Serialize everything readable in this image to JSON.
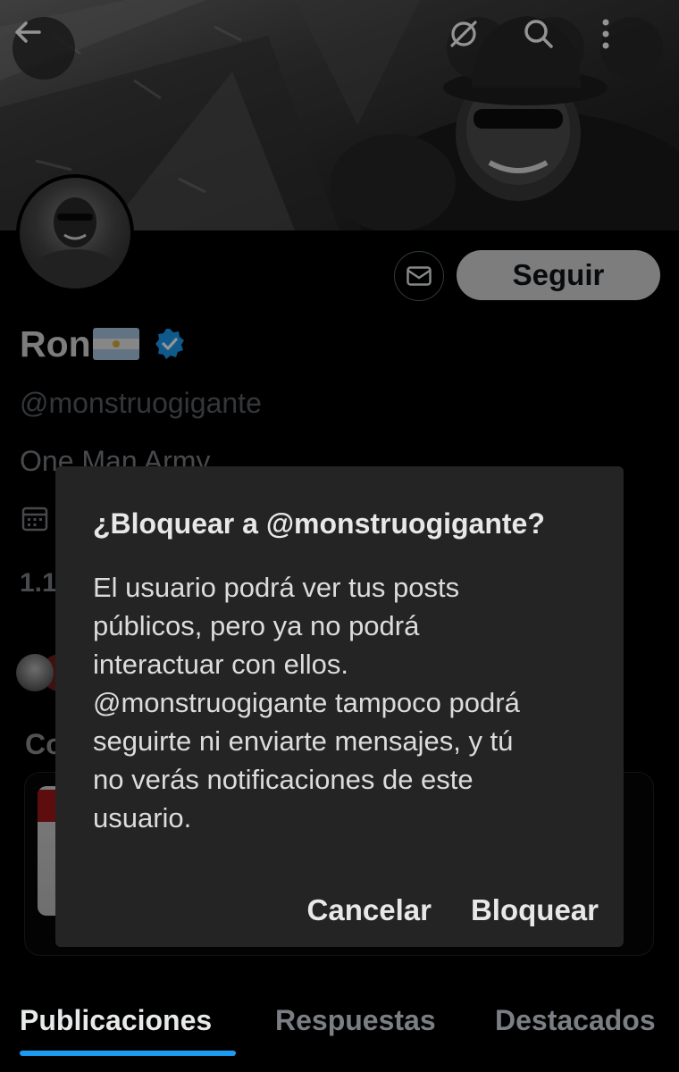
{
  "header": {
    "back_icon": "arrow-left-icon",
    "grok_icon": "grok-icon",
    "search_icon": "search-icon",
    "more_icon": "more-vertical-icon"
  },
  "profile": {
    "name": "Ron",
    "flag": "argentina-flag",
    "verified": true,
    "handle": "@monstruogigante",
    "bio": "One Man Army",
    "stat_partial": "1.1",
    "section_partial": "Co",
    "follow_label": "Seguir",
    "message_icon": "envelope-icon",
    "calendar_icon": "calendar-icon"
  },
  "dialog": {
    "title": "¿Bloquear a @monstruogigante?",
    "body": "El usuario podrá ver tus posts públicos, pero ya no podrá interactuar con ellos. @monstruogigante tampoco podrá seguirte ni enviarte mensajes, y tú no verás notificaciones de este usuario.",
    "cancel_label": "Cancelar",
    "confirm_label": "Bloquear"
  },
  "tabs": [
    {
      "label": "Publicaciones",
      "active": true
    },
    {
      "label": "Respuestas",
      "active": false
    },
    {
      "label": "Destacados",
      "active": false
    }
  ],
  "colors": {
    "accent": "#1d9bf0",
    "background": "#000000",
    "dialog": "#242424"
  }
}
